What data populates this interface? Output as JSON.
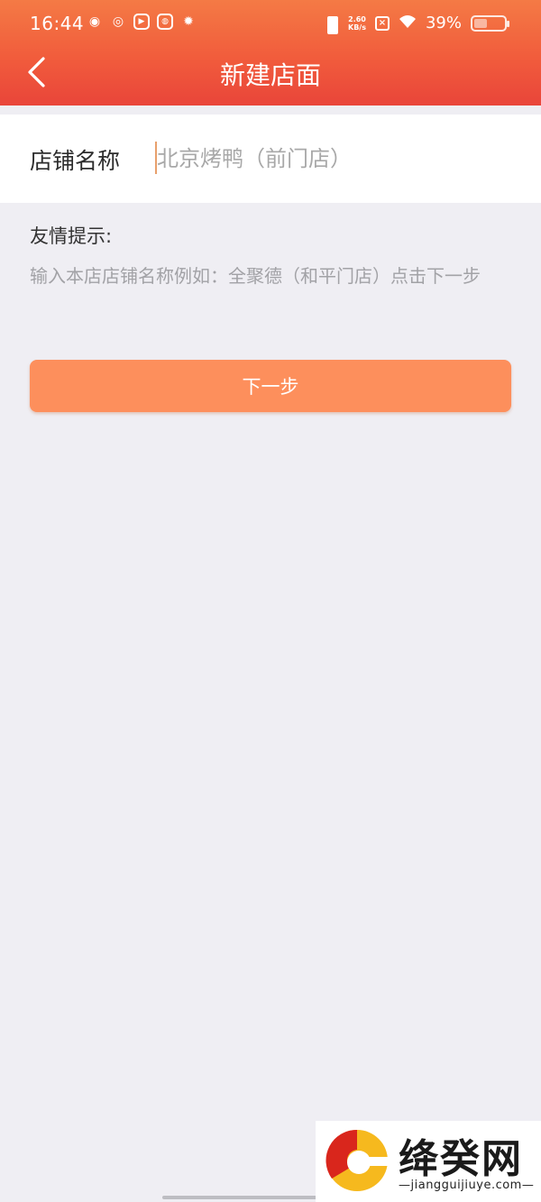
{
  "status_bar": {
    "time": "16:44",
    "net_speed_value": "2.60",
    "net_speed_unit": "KB/s",
    "battery_percent": "39%",
    "battery_level": 0.39
  },
  "nav": {
    "title": "新建店面",
    "back_icon": "chevron-left-icon"
  },
  "form": {
    "label": "店铺名称",
    "placeholder": "北京烤鸭（前门店）",
    "value": ""
  },
  "tip": {
    "title": "友情提示:",
    "text": "输入本店店铺名称例如：全聚德（和平门店）点击下一步"
  },
  "next_button": {
    "label": "下一步"
  },
  "watermark": {
    "name": "绛癸网",
    "url": "—jiangguijiuye.com—"
  },
  "colors": {
    "header_start": "#f47a45",
    "header_end": "#e9453a",
    "button": "#fd8f5c",
    "background": "#efeef3"
  }
}
